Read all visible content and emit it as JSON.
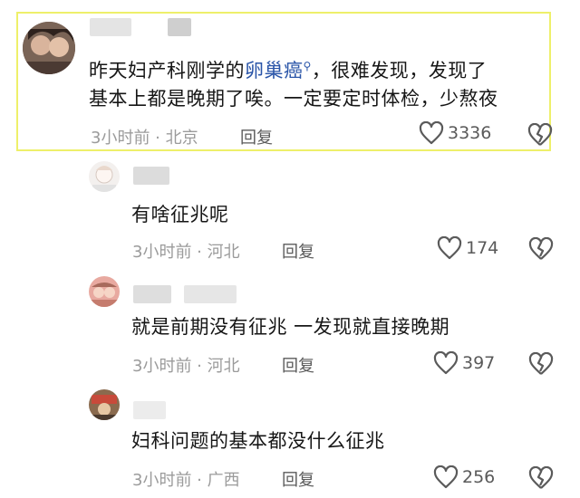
{
  "comments": [
    {
      "text_before": "昨天妇产科刚学的",
      "keyword": "卵巢癌",
      "keyword_icon": "search-icon",
      "text_after": "，很难发现，发现了",
      "text_line2": "基本上都是晚期了唉。一定要定时体检，少熬夜",
      "time_location": "3小时前 · 北京",
      "reply_label": "回复",
      "likes": "3336",
      "highlight_color": "#eef06a"
    },
    {
      "text": "有啥征兆呢",
      "time_location": "3小时前 · 河北",
      "reply_label": "回复",
      "likes": "174"
    },
    {
      "text": "就是前期没有征兆 一发现就直接晚期",
      "time_location": "3小时前 · 河北",
      "reply_label": "回复",
      "likes": "397"
    },
    {
      "text": "妇科问题的基本都没什么征兆",
      "time_location": "3小时前 · 广西",
      "reply_label": "回复",
      "likes": "256"
    }
  ],
  "icons": {
    "like": "heart-outline-icon",
    "dislike": "broken-heart-icon"
  }
}
